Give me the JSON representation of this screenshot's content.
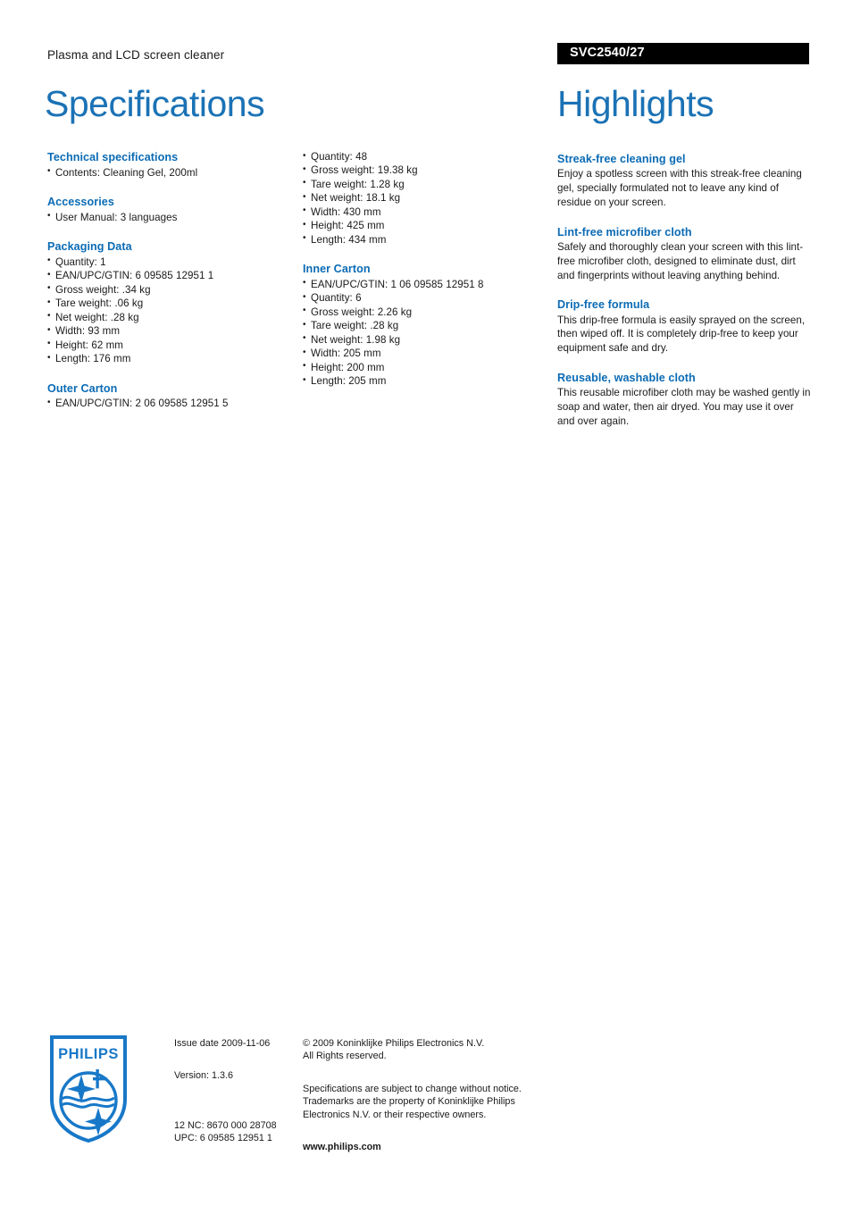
{
  "header": {
    "product_subtitle": "Plasma and LCD screen cleaner",
    "model_number": "SVC2540/27"
  },
  "titles": {
    "specifications": "Specifications",
    "highlights": "Highlights"
  },
  "specifications": {
    "column1": [
      {
        "heading": "Technical specifications",
        "items": [
          "Contents: Cleaning Gel, 200ml"
        ]
      },
      {
        "heading": "Accessories",
        "items": [
          "User Manual: 3 languages"
        ]
      },
      {
        "heading": "Packaging Data",
        "items": [
          "Quantity: 1",
          "EAN/UPC/GTIN: 6 09585 12951 1",
          "Gross weight: .34 kg",
          "Tare weight: .06 kg",
          "Net weight: .28 kg",
          "Width: 93 mm",
          "Height: 62 mm",
          "Length: 176 mm"
        ]
      },
      {
        "heading": "Outer Carton",
        "items": [
          "EAN/UPC/GTIN: 2 06 09585 12951 5"
        ]
      }
    ],
    "column2": [
      {
        "heading": "",
        "items": [
          "Quantity: 48",
          "Gross weight: 19.38 kg",
          "Tare weight: 1.28 kg",
          "Net weight: 18.1 kg",
          "Width: 430 mm",
          "Height: 425 mm",
          "Length: 434 mm"
        ]
      },
      {
        "heading": "Inner Carton",
        "items": [
          "EAN/UPC/GTIN: 1 06 09585 12951 8",
          "Quantity: 6",
          "Gross weight: 2.26 kg",
          "Tare weight: .28 kg",
          "Net weight: 1.98 kg",
          "Width: 205 mm",
          "Height: 200 mm",
          "Length: 205 mm"
        ]
      }
    ]
  },
  "highlights": [
    {
      "heading": "Streak-free cleaning gel",
      "body": "Enjoy a spotless screen with this streak-free cleaning gel, specially formulated not to leave any kind of residue on your screen."
    },
    {
      "heading": "Lint-free microfiber cloth",
      "body": "Safely and thoroughly clean your screen with this lint-free microfiber cloth, designed to eliminate dust, dirt and fingerprints without leaving anything behind."
    },
    {
      "heading": "Drip-free formula",
      "body": "This drip-free formula is easily sprayed on the screen, then wiped off. It is completely drip-free to keep your equipment safe and dry."
    },
    {
      "heading": "Reusable, washable cloth",
      "body": "This reusable microfiber cloth may be washed gently in soap and water, then air dryed. You may use it over and over again."
    }
  ],
  "footer": {
    "logo_wordmark": "PHILIPS",
    "issue_date": "Issue date 2009-11-06",
    "version": "Version: 1.3.6",
    "twelve_nc": "12 NC: 8670 000 28708",
    "upc": "UPC: 6 09585 12951 1",
    "copyright_line1": "© 2009 Koninklijke Philips Electronics N.V.",
    "copyright_line2": "All Rights reserved.",
    "disclaimer": "Specifications are subject to change without notice. Trademarks are the property of Koninklijke Philips Electronics N.V. or their respective owners.",
    "website": "www.philips.com"
  },
  "colors": {
    "heading_blue": "#0b6bb5",
    "title_blue": "#1b72b5",
    "model_bar_bg": "#000000",
    "logo_blue": "#1878c8"
  }
}
